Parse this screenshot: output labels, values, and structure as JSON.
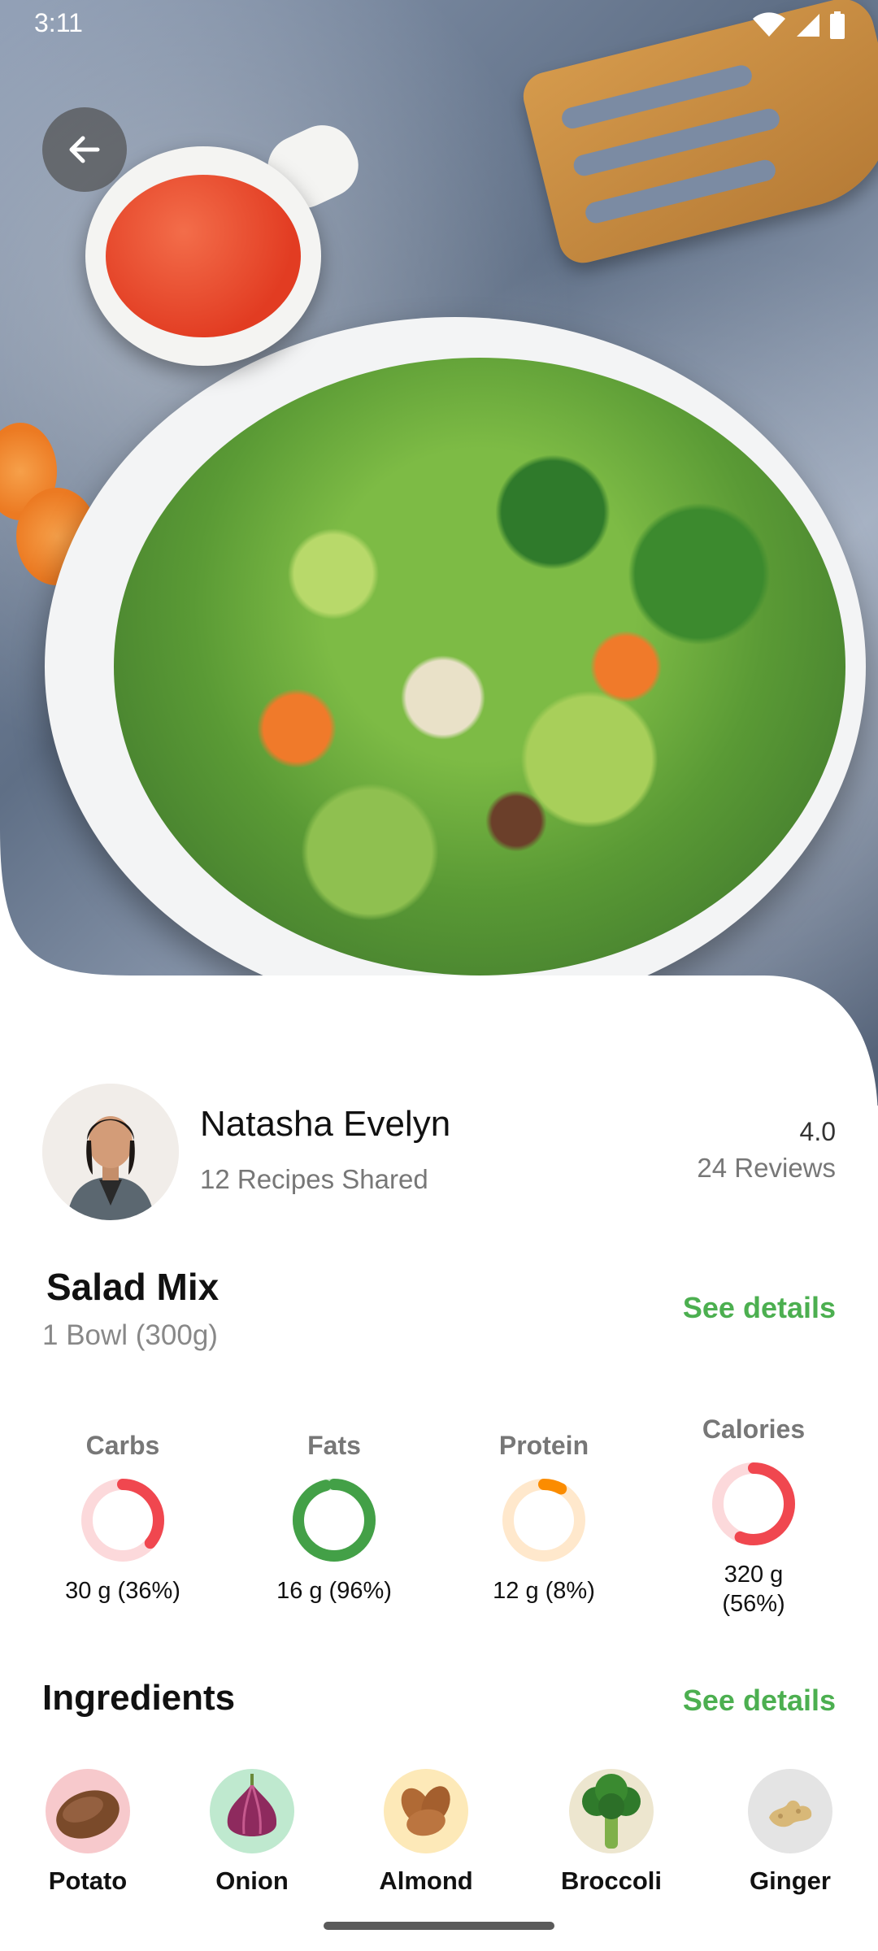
{
  "status_bar": {
    "time": "3:11",
    "icons": [
      "wifi-icon",
      "cell-signal-icon",
      "battery-icon"
    ]
  },
  "header": {
    "back_icon": "arrow-left-icon"
  },
  "author": {
    "name": "Natasha Evelyn",
    "recipes_shared": "12 Recipes Shared",
    "rating": "4.0",
    "reviews": "24 Reviews"
  },
  "recipe": {
    "title": "Salad Mix",
    "serving": "1 Bowl (300g)",
    "see_details_label": "See details"
  },
  "nutrition": [
    {
      "label": "Carbs",
      "value": "30 g (36%)",
      "percent": 36,
      "color": "#f0474f",
      "track": "#fcd9db"
    },
    {
      "label": "Fats",
      "value": "16 g (96%)",
      "percent": 96,
      "color": "#43a047",
      "track": "#c8e6c9"
    },
    {
      "label": "Protein",
      "value": "12 g (8%)",
      "percent": 8,
      "color": "#fb8c00",
      "track": "#ffe8cc"
    },
    {
      "label": "Calories",
      "value": "320 g (56%)",
      "percent": 56,
      "color": "#f0474f",
      "track": "#fcd9db"
    }
  ],
  "ingredients": {
    "title": "Ingredients",
    "see_details_label": "See details",
    "items": [
      {
        "label": "Potato",
        "bg": "#f7c9cc"
      },
      {
        "label": "Onion",
        "bg": "#bfe9cf"
      },
      {
        "label": "Almond",
        "bg": "#fde9b8"
      },
      {
        "label": "Broccoli",
        "bg": "#ede6cf"
      },
      {
        "label": "Ginger",
        "bg": "#e4e4e4"
      }
    ]
  },
  "colors": {
    "accent": "#4caf50",
    "text_primary": "#111111",
    "text_secondary": "#777777"
  }
}
